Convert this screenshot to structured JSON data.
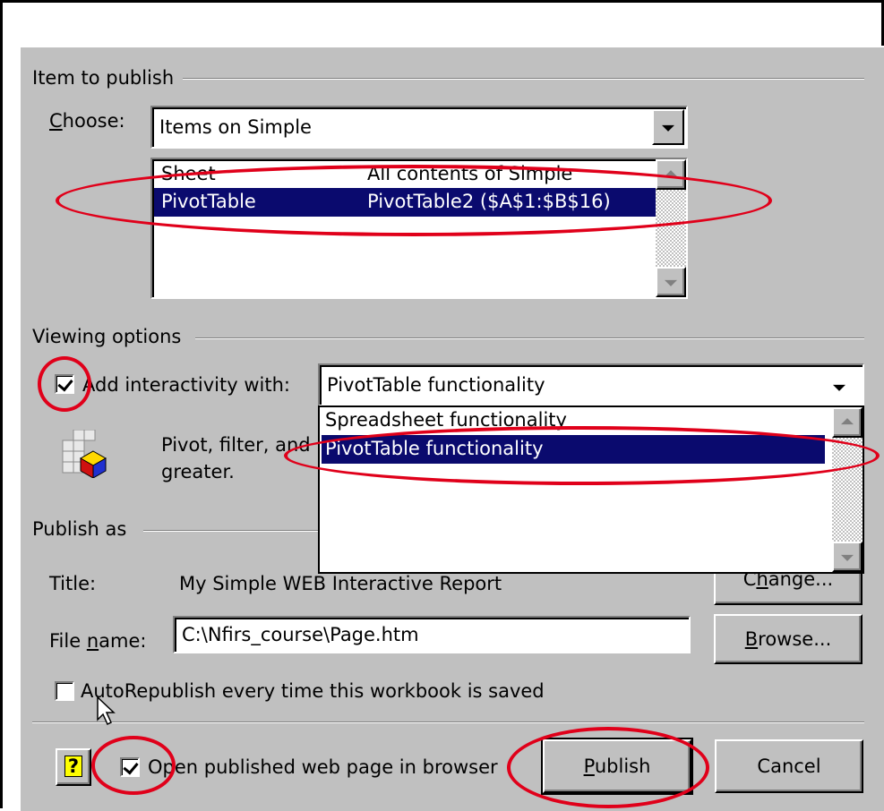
{
  "item_to_publish": {
    "group_label": "Item to publish",
    "choose_label": "Choose:",
    "choose_value": "Items on Simple",
    "list": [
      {
        "type": "Sheet",
        "desc": "All contents of Simple",
        "selected": false
      },
      {
        "type": "PivotTable",
        "desc": "PivotTable2 ($A$1:$B$16)",
        "selected": true
      }
    ]
  },
  "viewing_options": {
    "group_label": "Viewing options",
    "add_interactivity_label": "Add interactivity with:",
    "add_interactivity_checked": true,
    "interactivity_value": "PivotTable functionality",
    "dropdown_options": [
      {
        "label": "Spreadsheet functionality",
        "selected": false
      },
      {
        "label": "PivotTable functionality",
        "selected": true
      }
    ],
    "description_line1": "Pivot, filter, and",
    "description_line2": "greater."
  },
  "publish_as": {
    "group_label": "Publish as",
    "title_label": "Title:",
    "title_value": "My Simple WEB Interactive Report",
    "change_button": "Change...",
    "filename_label": "File name:",
    "filename_value": "C:\\Nfirs_course\\Page.htm",
    "browse_button": "Browse...",
    "autorepublish_label": "AutoRepublish every time this workbook is saved",
    "autorepublish_checked": false
  },
  "footer": {
    "help_icon": "?",
    "open_in_browser_label": "Open published web page in browser",
    "open_in_browser_checked": true,
    "publish_button": "Publish",
    "cancel_button": "Cancel"
  },
  "colors": {
    "dialog_bg": "#c0c0c0",
    "selection_bg": "#0a0a6e",
    "annotation_red": "#e0001a"
  }
}
